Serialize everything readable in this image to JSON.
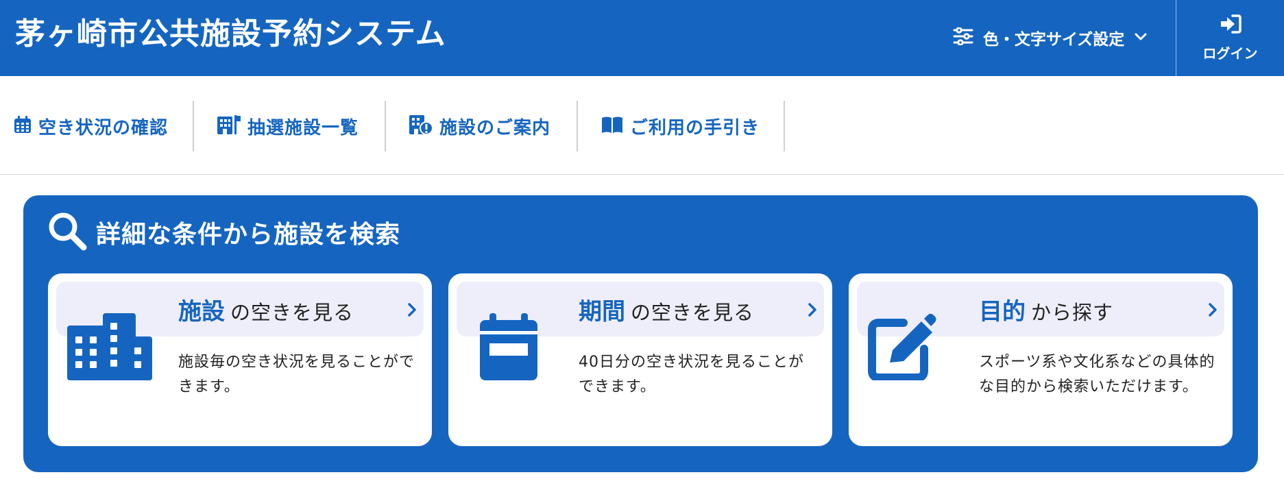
{
  "header": {
    "title": "茅ヶ崎市公共施設予約システム",
    "settings_label": "色・文字サイズ設定",
    "login_label": "ログイン"
  },
  "nav": {
    "items": [
      {
        "label": "空き状況の確認",
        "icon": "calendar-icon"
      },
      {
        "label": "抽選施設一覧",
        "icon": "building-flag-icon"
      },
      {
        "label": "施設のご案内",
        "icon": "building-info-icon"
      },
      {
        "label": "ご利用の手引き",
        "icon": "book-icon"
      }
    ]
  },
  "search": {
    "heading": "詳細な条件から施設を検索",
    "cards": [
      {
        "title_strong": "施設",
        "title_rest": "の空きを見る",
        "description": "施設毎の空き状況を見ることができます。",
        "icon": "building-icon"
      },
      {
        "title_strong": "期間",
        "title_rest": "の空きを見る",
        "description": "40日分の空き状況を見ることができます。",
        "icon": "calendar-icon"
      },
      {
        "title_strong": "目的",
        "title_rest": "から探す",
        "description": "スポーツ系や文化系などの具体的な目的から検索いただけます。",
        "icon": "edit-icon"
      }
    ]
  },
  "colors": {
    "primary": "#1565c0",
    "card_band": "#eeeefb",
    "divider": "#cfcfcf"
  }
}
